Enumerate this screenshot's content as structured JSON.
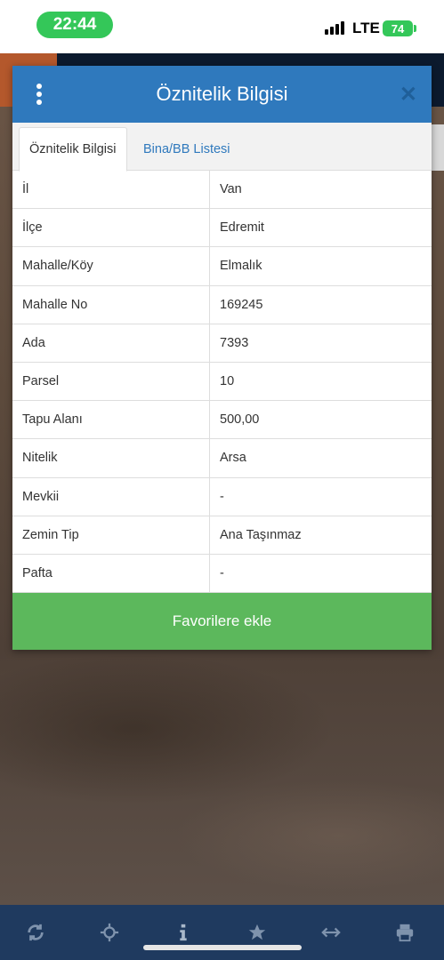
{
  "status_bar": {
    "time": "22:44",
    "network": "LTE",
    "battery": "74"
  },
  "dialog": {
    "title": "Öznitelik Bilgisi",
    "tabs": [
      {
        "label": "Öznitelik Bilgisi",
        "active": true
      },
      {
        "label": "Bina/BB Listesi",
        "active": false
      }
    ],
    "rows": [
      {
        "key": "İl",
        "value": "Van"
      },
      {
        "key": "İlçe",
        "value": "Edremit"
      },
      {
        "key": "Mahalle/Köy",
        "value": "Elmalık"
      },
      {
        "key": "Mahalle No",
        "value": "169245"
      },
      {
        "key": "Ada",
        "value": "7393"
      },
      {
        "key": "Parsel",
        "value": "10"
      },
      {
        "key": "Tapu Alanı",
        "value": "500,00"
      },
      {
        "key": "Nitelik",
        "value": "Arsa"
      },
      {
        "key": "Mevkii",
        "value": "-"
      },
      {
        "key": "Zemin Tip",
        "value": "Ana Taşınmaz"
      },
      {
        "key": "Pafta",
        "value": "-"
      }
    ],
    "favorite_button": "Favorilere ekle",
    "colors": {
      "header": "#2f79bd",
      "button": "#5cb85c",
      "tab_link": "#2f79bd"
    }
  },
  "toolbar": {
    "icons": [
      "refresh-icon",
      "locate-icon",
      "info-icon",
      "star-icon",
      "measure-icon",
      "print-icon"
    ]
  }
}
